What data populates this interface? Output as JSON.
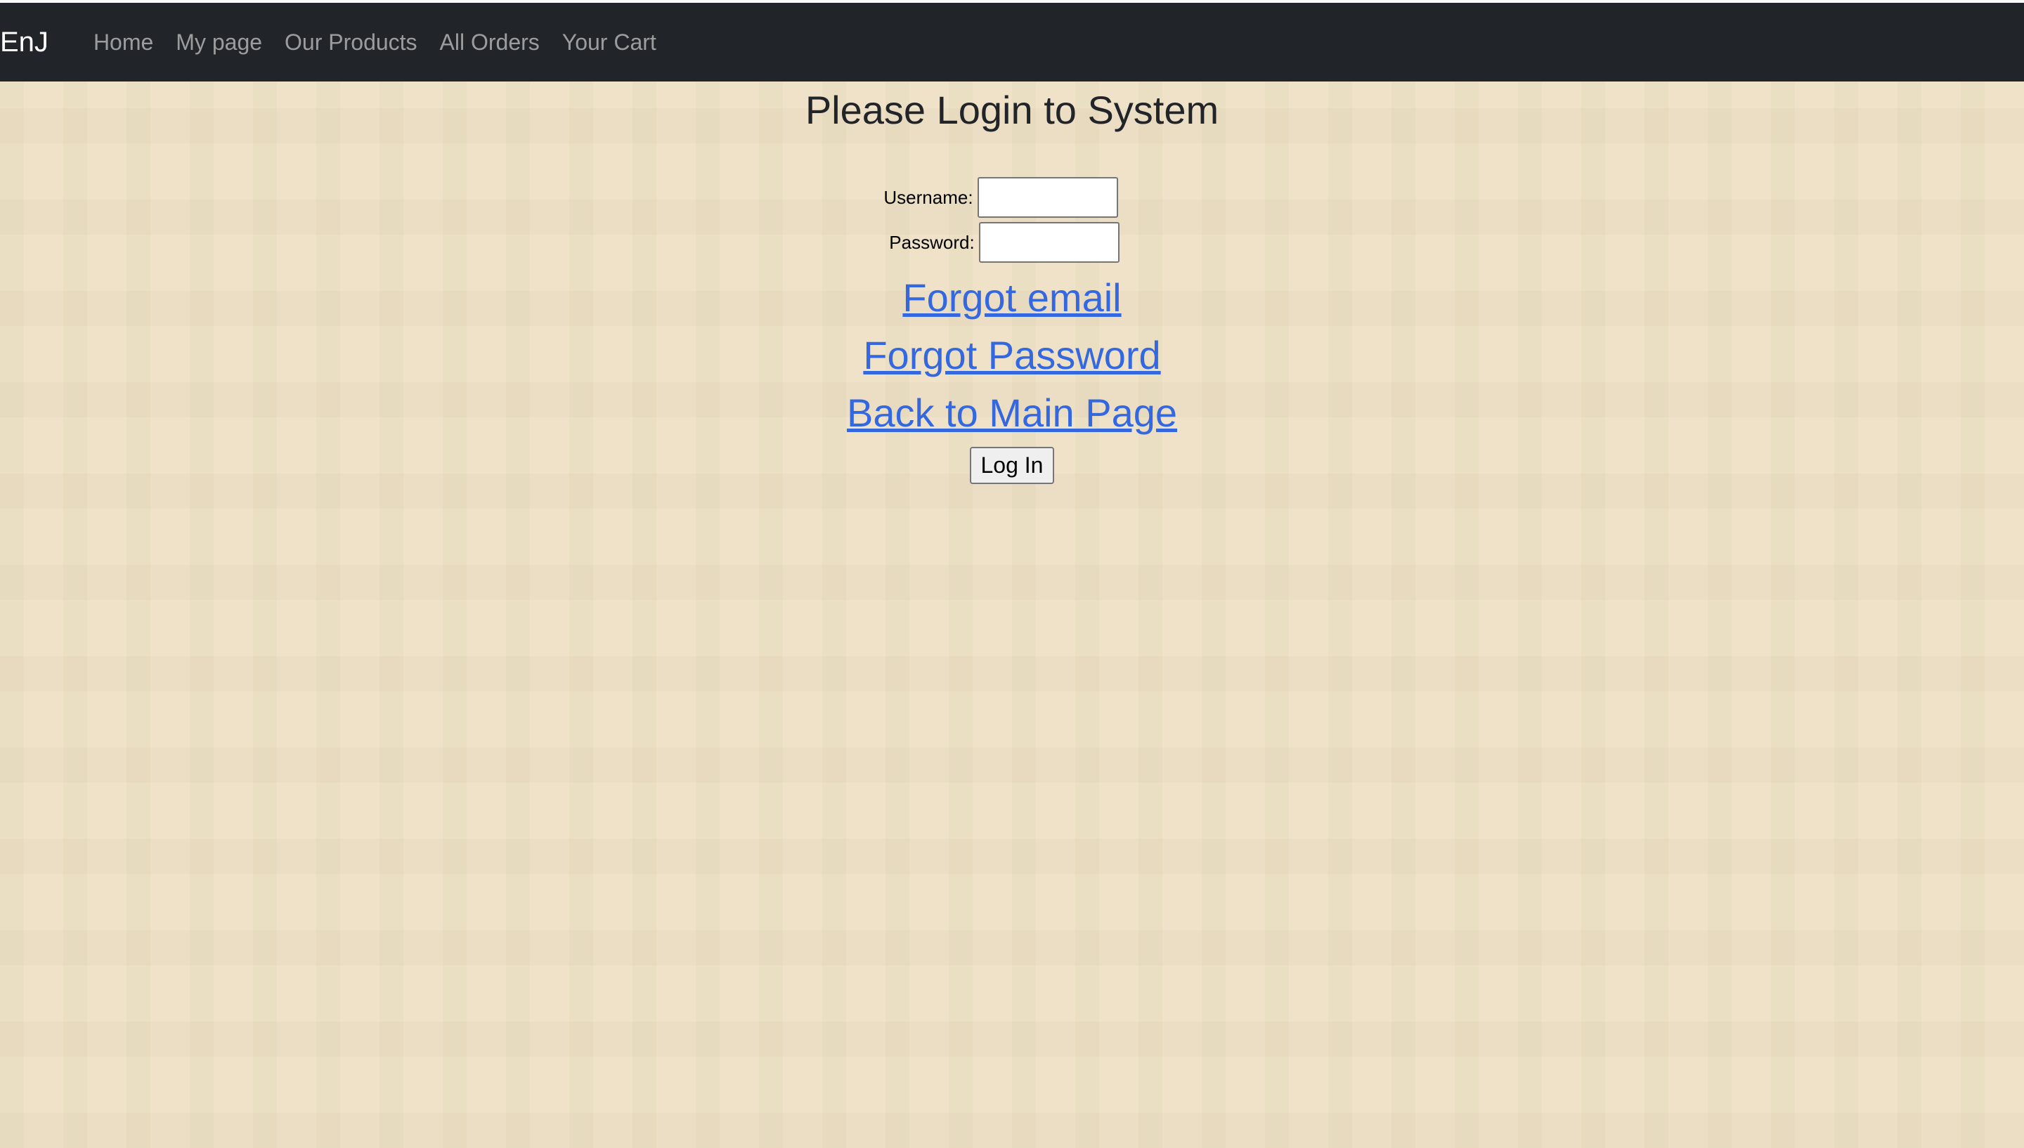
{
  "navbar": {
    "brand": "EnJ",
    "links": [
      "Home",
      "My page",
      "Our Products",
      "All Orders",
      "Your Cart"
    ]
  },
  "page": {
    "title": "Please Login to System"
  },
  "form": {
    "username_label": "Username:",
    "username_value": "",
    "password_label": "Password:",
    "password_value": "",
    "login_button": "Log In"
  },
  "links": {
    "forgot_email": "Forgot email",
    "forgot_password": "Forgot Password",
    "back_to_main": "Back to Main Page"
  },
  "colors": {
    "navbar_bg": "#212529",
    "page_bg": "#efe1c6",
    "link": "#3468e0"
  }
}
